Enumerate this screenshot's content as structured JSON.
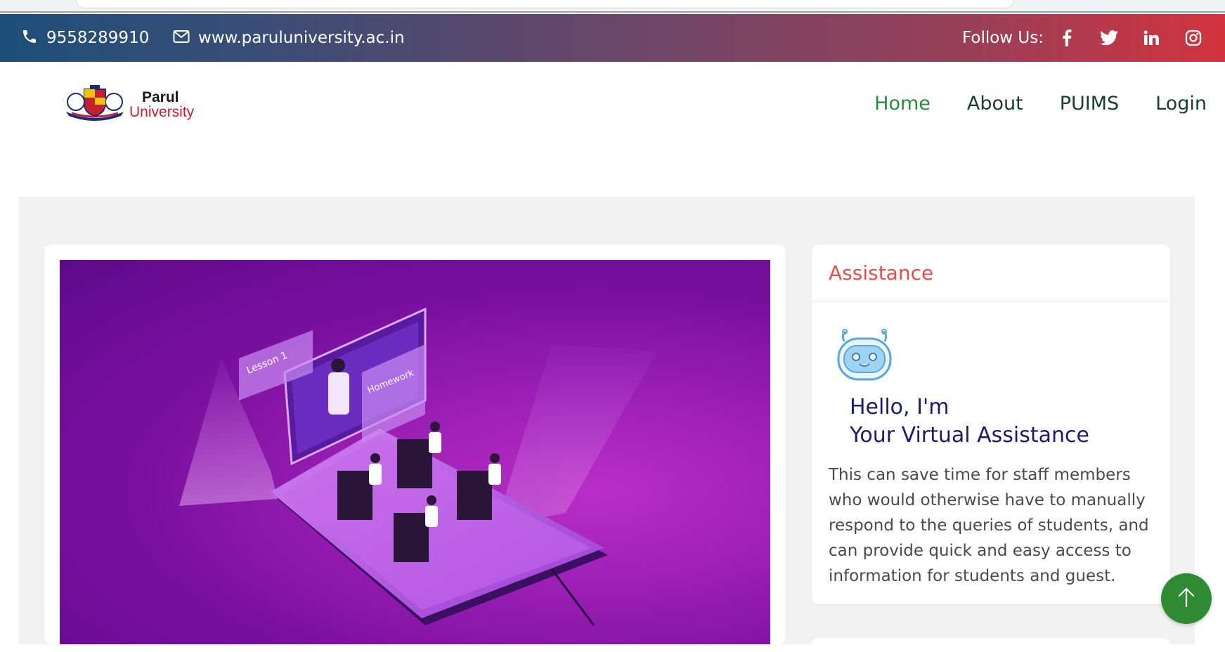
{
  "topbar": {
    "phone": "9558289910",
    "website": "www.paruluniversity.ac.in",
    "follow_label": "Follow Us:",
    "social_icons": [
      "facebook-icon",
      "twitter-icon",
      "linkedin-icon",
      "instagram-icon"
    ],
    "gradient_colors": [
      "#1d4e78",
      "#6c4667",
      "#d2333e"
    ]
  },
  "logo": {
    "line1": "Parul",
    "line2": "University"
  },
  "nav": {
    "items": [
      {
        "label": "Home",
        "active": true
      },
      {
        "label": "About",
        "active": false
      },
      {
        "label": "PUIMS",
        "active": false
      },
      {
        "label": "Login",
        "active": false
      }
    ],
    "active_color": "#2a8a3a"
  },
  "hero": {
    "illustration_labels": {
      "lesson": "Lesson 1",
      "homework": "Homework"
    }
  },
  "assistance": {
    "title": "Assistance",
    "hello_line1": "Hello, I'm",
    "hello_line2": "Your Virtual Assistance",
    "body": "This can save time for staff members who would otherwise have to manually respond to the queries of students, and can provide quick and easy access to information for students and guest.",
    "title_color": "#e34f4f"
  },
  "scroll_top": {
    "icon": "arrow-up-icon",
    "color": "#2e8a33"
  }
}
